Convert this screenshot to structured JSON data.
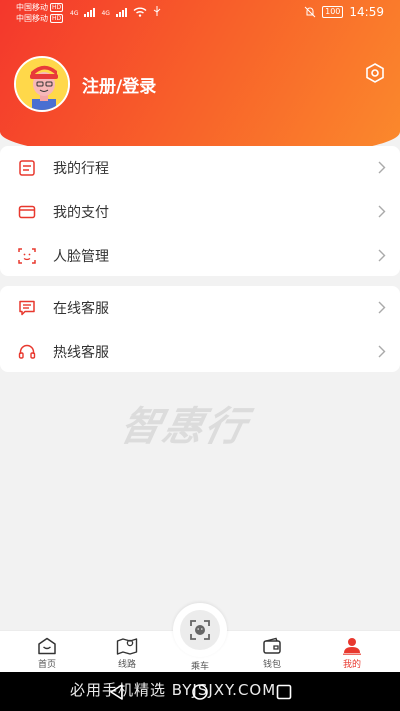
{
  "status_bar": {
    "carrier_1": "中国移动",
    "carrier_2": "中国移动",
    "badge": "HD",
    "net": "4G",
    "battery": "100",
    "time": "14:59"
  },
  "profile": {
    "login_label": "注册/登录"
  },
  "menu_group_1": [
    {
      "label": "我的行程",
      "icon": "itinerary-icon"
    },
    {
      "label": "我的支付",
      "icon": "payment-card-icon"
    },
    {
      "label": "人脸管理",
      "icon": "face-scan-icon"
    }
  ],
  "menu_group_2": [
    {
      "label": "在线客服",
      "icon": "chat-bubble-icon"
    },
    {
      "label": "热线客服",
      "icon": "headset-icon"
    }
  ],
  "watermark": "智惠行",
  "tabbar": {
    "tabs": [
      {
        "label": "首页",
        "icon": "home-icon"
      },
      {
        "label": "线路",
        "icon": "map-pin-icon"
      },
      {
        "label": "乘车",
        "icon": "scan-face-icon"
      },
      {
        "label": "钱包",
        "icon": "wallet-icon"
      },
      {
        "label": "我的",
        "icon": "user-icon"
      }
    ],
    "active_index": 4
  },
  "overlay_text": "必用手机精选 BYJSJXY.COM",
  "colors": {
    "accent": "#e8382e",
    "gradient_start": "#f4372c",
    "gradient_end": "#fb8a2c"
  }
}
